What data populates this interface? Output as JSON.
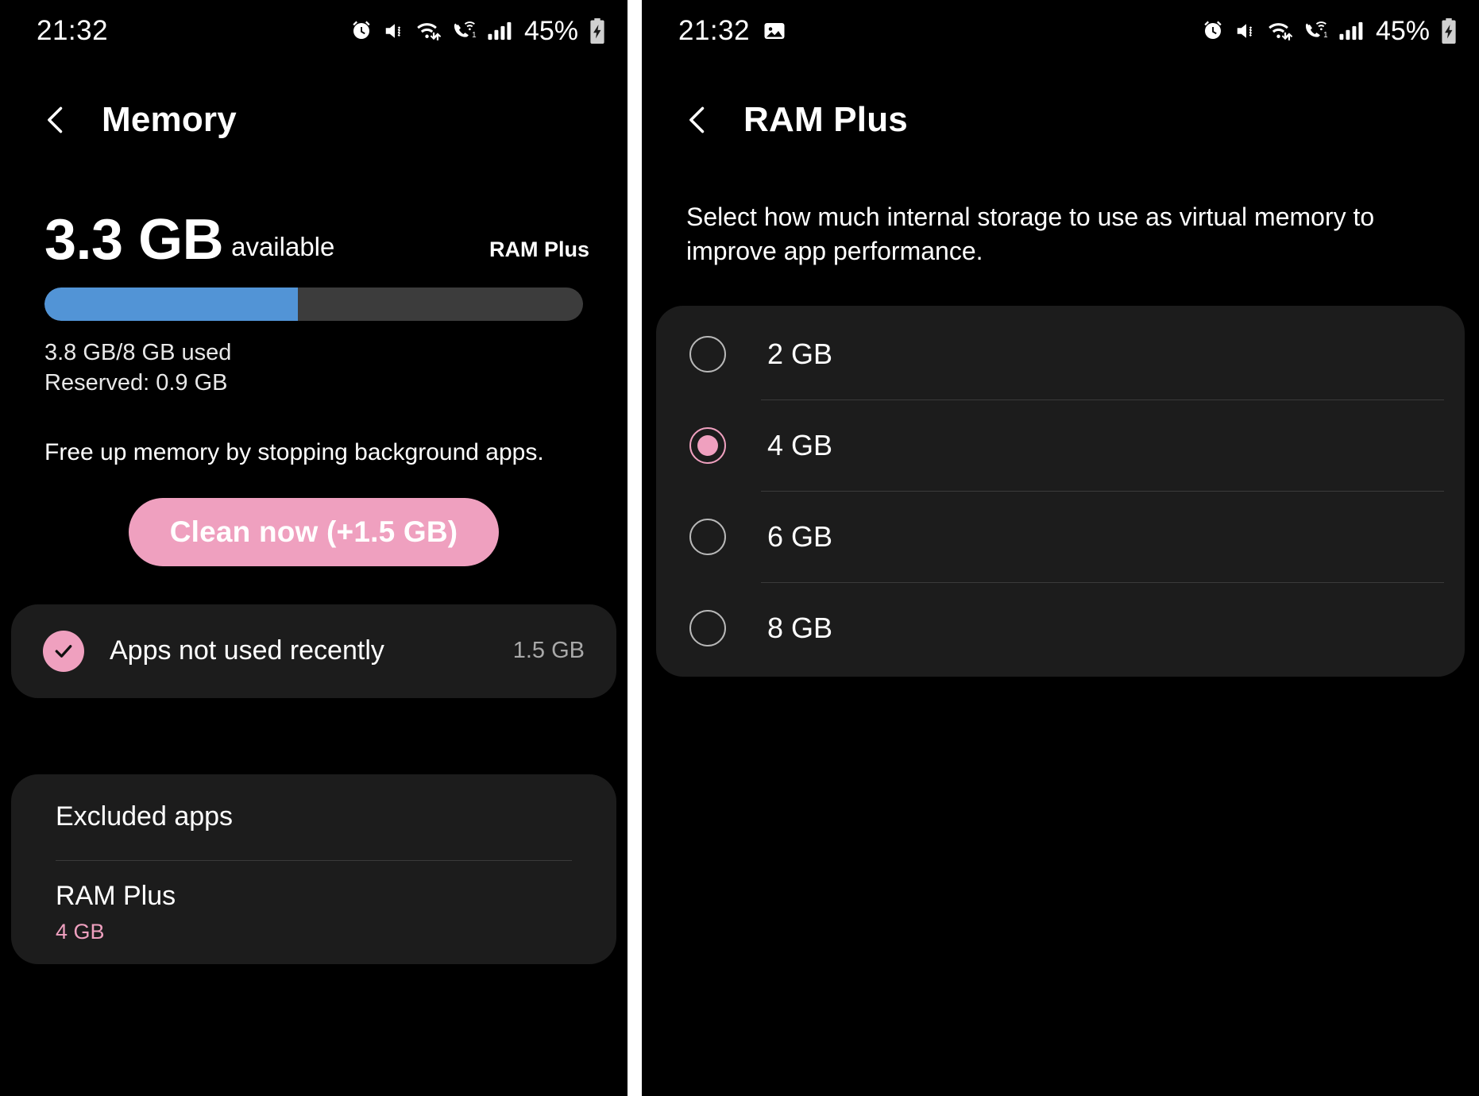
{
  "colors": {
    "accent_pink": "#efa0bf",
    "progress_blue": "#5294d6",
    "progress_track": "#3c3c3c",
    "card_bg": "#1c1c1c",
    "screen_bg": "#000000"
  },
  "left_screen": {
    "status_bar": {
      "time": "21:32",
      "battery_percent": "45%",
      "icons": [
        "alarm-icon",
        "mute-vibrate-icon",
        "wifi-data-icon",
        "wifi-calling-icon",
        "signal-bars-icon",
        "battery-charging-icon"
      ]
    },
    "app_bar": {
      "back": "back-chevron-icon",
      "title": "Memory"
    },
    "summary": {
      "available_value": "3.3 GB",
      "available_label": "available",
      "ram_plus_tag": "RAM Plus",
      "used_line": "3.8 GB/8 GB used",
      "reserved_line": "Reserved: 0.9 GB",
      "progress_percent": 47
    },
    "hint": "Free up memory by stopping background apps.",
    "clean_button": "Clean now (+1.5 GB)",
    "apps_card": {
      "check_icon": "check-icon",
      "label": "Apps not used recently",
      "size": "1.5 GB"
    },
    "list": [
      {
        "title": "Excluded apps",
        "sub": ""
      },
      {
        "title": "RAM Plus",
        "sub": "4 GB"
      }
    ]
  },
  "right_screen": {
    "status_bar": {
      "time": "21:32",
      "battery_percent": "45%",
      "screenshot_icon": "image-icon",
      "icons": [
        "alarm-icon",
        "mute-vibrate-icon",
        "wifi-data-icon",
        "wifi-calling-icon",
        "signal-bars-icon",
        "battery-charging-icon"
      ]
    },
    "app_bar": {
      "back": "back-chevron-icon",
      "title": "RAM Plus"
    },
    "description": "Select how much internal storage to use as virtual memory to improve app performance.",
    "options": [
      {
        "label": "2 GB",
        "selected": false
      },
      {
        "label": "4 GB",
        "selected": true
      },
      {
        "label": "6 GB",
        "selected": false
      },
      {
        "label": "8 GB",
        "selected": false
      }
    ]
  }
}
